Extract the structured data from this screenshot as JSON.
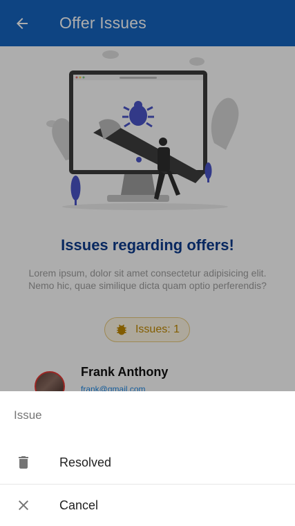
{
  "app_bar": {
    "title": "Offer Issues",
    "back_icon": "arrow-left-icon",
    "color": "#1565c0"
  },
  "main": {
    "heading": "Issues regarding offers!",
    "description": "Lorem ipsum, dolor sit amet consectetur adipisicing elit. Nemo hic, quae similique dicta quam optio perferendis?",
    "issues_chip": {
      "label": "Issues: 1",
      "icon": "bug-icon"
    },
    "user": {
      "name": "Frank Anthony",
      "email": "frank@gmail.com"
    }
  },
  "bottom_sheet": {
    "title": "Issue",
    "items": [
      {
        "label": "Resolved",
        "icon": "trash-icon"
      },
      {
        "label": "Cancel",
        "icon": "close-icon"
      }
    ]
  }
}
